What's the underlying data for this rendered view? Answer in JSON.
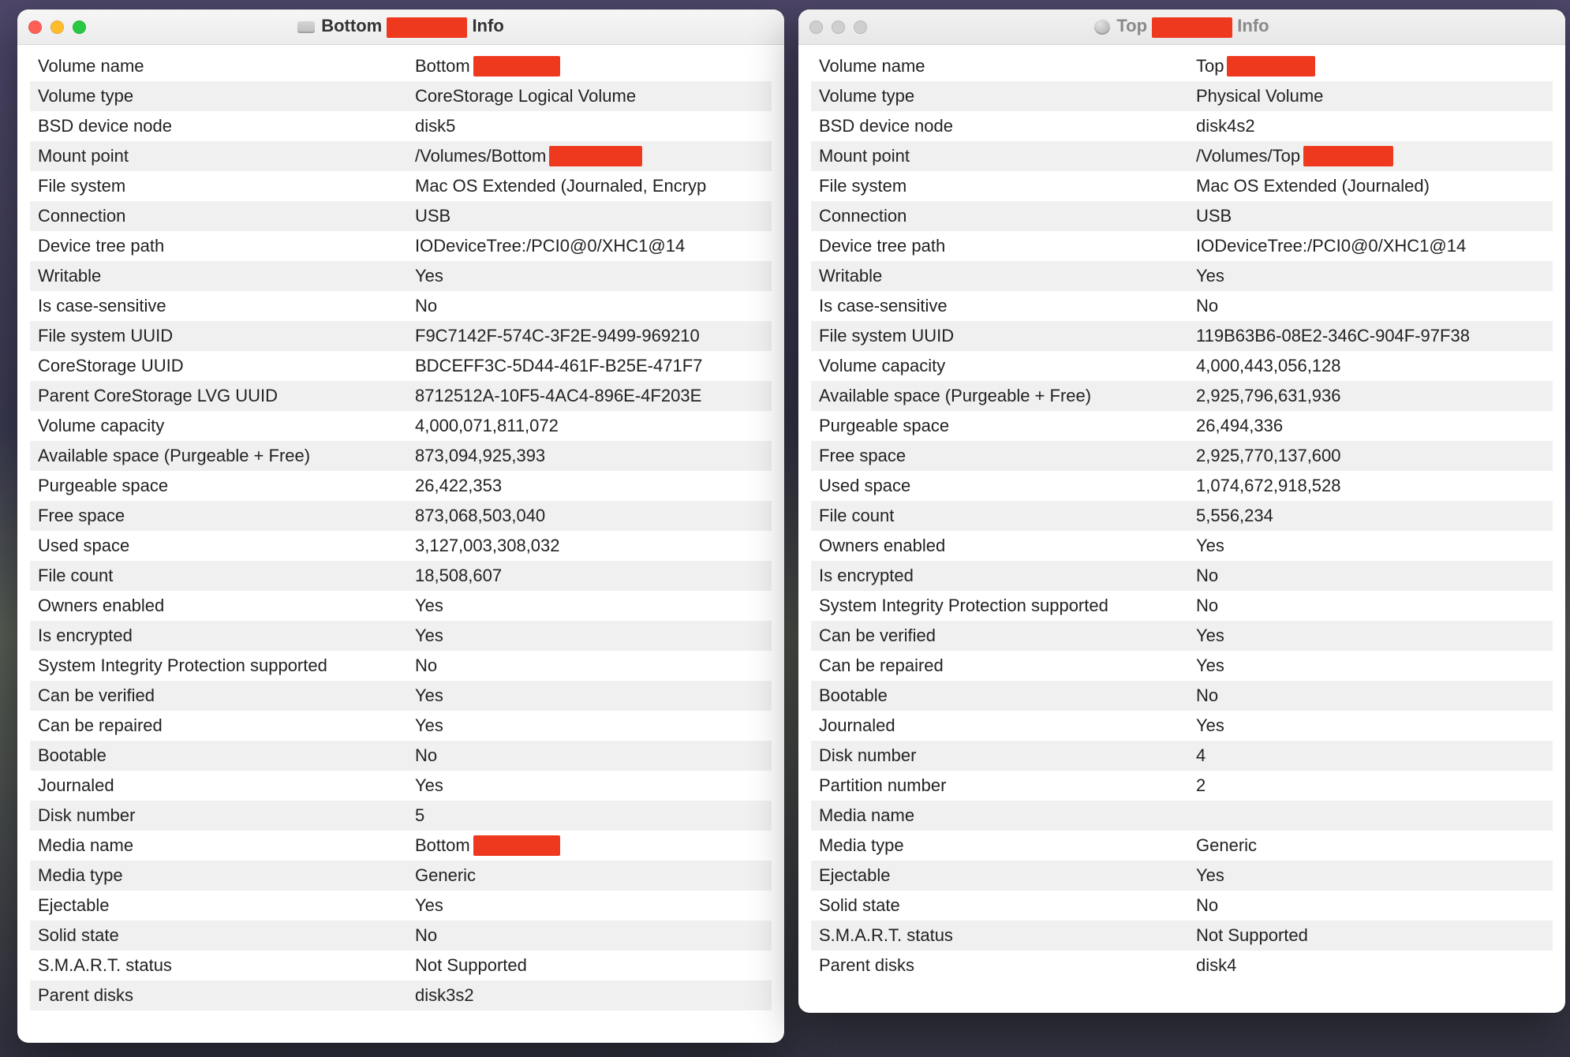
{
  "windows": {
    "left": {
      "active": true,
      "title_prefix": "Bottom ",
      "title_suffix": " Info",
      "title_redact_width": 102,
      "rows": [
        {
          "label": "Volume name",
          "value": "Bottom ",
          "redact_after_width": 110
        },
        {
          "label": "Volume type",
          "value": "CoreStorage Logical Volume"
        },
        {
          "label": "BSD device node",
          "value": "disk5"
        },
        {
          "label": "Mount point",
          "value": "/Volumes/Bottom ",
          "redact_after_width": 118
        },
        {
          "label": "File system",
          "value": "Mac OS Extended (Journaled, Encryp"
        },
        {
          "label": "Connection",
          "value": "USB"
        },
        {
          "label": "Device tree path",
          "value": "IODeviceTree:/PCI0@0/XHC1@14"
        },
        {
          "label": "Writable",
          "value": "Yes"
        },
        {
          "label": "Is case-sensitive",
          "value": "No"
        },
        {
          "label": "File system UUID",
          "value": "F9C7142F-574C-3F2E-9499-969210"
        },
        {
          "label": "CoreStorage UUID",
          "value": "BDCEFF3C-5D44-461F-B25E-471F7"
        },
        {
          "label": "Parent CoreStorage LVG UUID",
          "value": "8712512A-10F5-4AC4-896E-4F203E"
        },
        {
          "label": "Volume capacity",
          "value": "4,000,071,811,072"
        },
        {
          "label": "Available space (Purgeable + Free)",
          "value": "873,094,925,393"
        },
        {
          "label": "Purgeable space",
          "value": "26,422,353"
        },
        {
          "label": "Free space",
          "value": "873,068,503,040"
        },
        {
          "label": "Used space",
          "value": "3,127,003,308,032"
        },
        {
          "label": "File count",
          "value": "18,508,607"
        },
        {
          "label": "Owners enabled",
          "value": "Yes"
        },
        {
          "label": "Is encrypted",
          "value": "Yes"
        },
        {
          "label": "System Integrity Protection supported",
          "value": "No"
        },
        {
          "label": "Can be verified",
          "value": "Yes"
        },
        {
          "label": "Can be repaired",
          "value": "Yes"
        },
        {
          "label": "Bootable",
          "value": "No"
        },
        {
          "label": "Journaled",
          "value": "Yes"
        },
        {
          "label": "Disk number",
          "value": "5"
        },
        {
          "label": "Media name",
          "value": "Bottom ",
          "redact_after_width": 110
        },
        {
          "label": "Media type",
          "value": "Generic"
        },
        {
          "label": "Ejectable",
          "value": "Yes"
        },
        {
          "label": "Solid state",
          "value": "No"
        },
        {
          "label": "S.M.A.R.T. status",
          "value": "Not Supported"
        },
        {
          "label": "Parent disks",
          "value": "disk3s2"
        }
      ]
    },
    "right": {
      "active": false,
      "title_prefix": "Top ",
      "title_suffix": " Info",
      "title_redact_width": 102,
      "rows": [
        {
          "label": "Volume name",
          "value": "Top ",
          "redact_after_width": 112
        },
        {
          "label": "Volume type",
          "value": "Physical Volume"
        },
        {
          "label": "BSD device node",
          "value": "disk4s2"
        },
        {
          "label": "Mount point",
          "value": "/Volumes/Top ",
          "redact_after_width": 114
        },
        {
          "label": "File system",
          "value": "Mac OS Extended (Journaled)"
        },
        {
          "label": "Connection",
          "value": "USB"
        },
        {
          "label": "Device tree path",
          "value": "IODeviceTree:/PCI0@0/XHC1@14"
        },
        {
          "label": "Writable",
          "value": "Yes"
        },
        {
          "label": "Is case-sensitive",
          "value": "No"
        },
        {
          "label": "File system UUID",
          "value": "119B63B6-08E2-346C-904F-97F38"
        },
        {
          "label": "Volume capacity",
          "value": "4,000,443,056,128"
        },
        {
          "label": "Available space (Purgeable + Free)",
          "value": "2,925,796,631,936"
        },
        {
          "label": "Purgeable space",
          "value": "26,494,336"
        },
        {
          "label": "Free space",
          "value": "2,925,770,137,600"
        },
        {
          "label": "Used space",
          "value": "1,074,672,918,528"
        },
        {
          "label": "File count",
          "value": "5,556,234"
        },
        {
          "label": "Owners enabled",
          "value": "Yes"
        },
        {
          "label": "Is encrypted",
          "value": "No"
        },
        {
          "label": "System Integrity Protection supported",
          "value": "No"
        },
        {
          "label": "Can be verified",
          "value": "Yes"
        },
        {
          "label": "Can be repaired",
          "value": "Yes"
        },
        {
          "label": "Bootable",
          "value": "No"
        },
        {
          "label": "Journaled",
          "value": "Yes"
        },
        {
          "label": "Disk number",
          "value": "4"
        },
        {
          "label": "Partition number",
          "value": "2"
        },
        {
          "label": "Media name",
          "value": ""
        },
        {
          "label": "Media type",
          "value": "Generic"
        },
        {
          "label": "Ejectable",
          "value": "Yes"
        },
        {
          "label": "Solid state",
          "value": "No"
        },
        {
          "label": "S.M.A.R.T. status",
          "value": "Not Supported"
        },
        {
          "label": "Parent disks",
          "value": "disk4"
        }
      ]
    }
  }
}
